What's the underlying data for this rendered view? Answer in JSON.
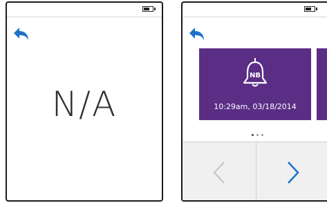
{
  "screens": [
    {
      "name": "left",
      "status_icon": "battery-icon",
      "back_icon": "back-arrow-icon",
      "main_text": "N/A"
    },
    {
      "name": "right",
      "status_icon": "battery-icon",
      "back_icon": "back-arrow-icon",
      "card": {
        "icon": "bell-icon",
        "badge": "NB",
        "timestamp": "10:29am, 03/18/2014",
        "color": "#5b2e86"
      },
      "page_dots": {
        "count": 3,
        "active_index": 0
      },
      "nav": {
        "prev_icon": "chevron-left-icon",
        "next_icon": "chevron-right-icon",
        "prev_enabled": false,
        "next_enabled": true
      }
    }
  ],
  "colors": {
    "accent_blue": "#1e73c9",
    "card_purple": "#5b2e86",
    "disabled_gray": "#c6c6c6",
    "nav_background": "#f0f0f0"
  }
}
